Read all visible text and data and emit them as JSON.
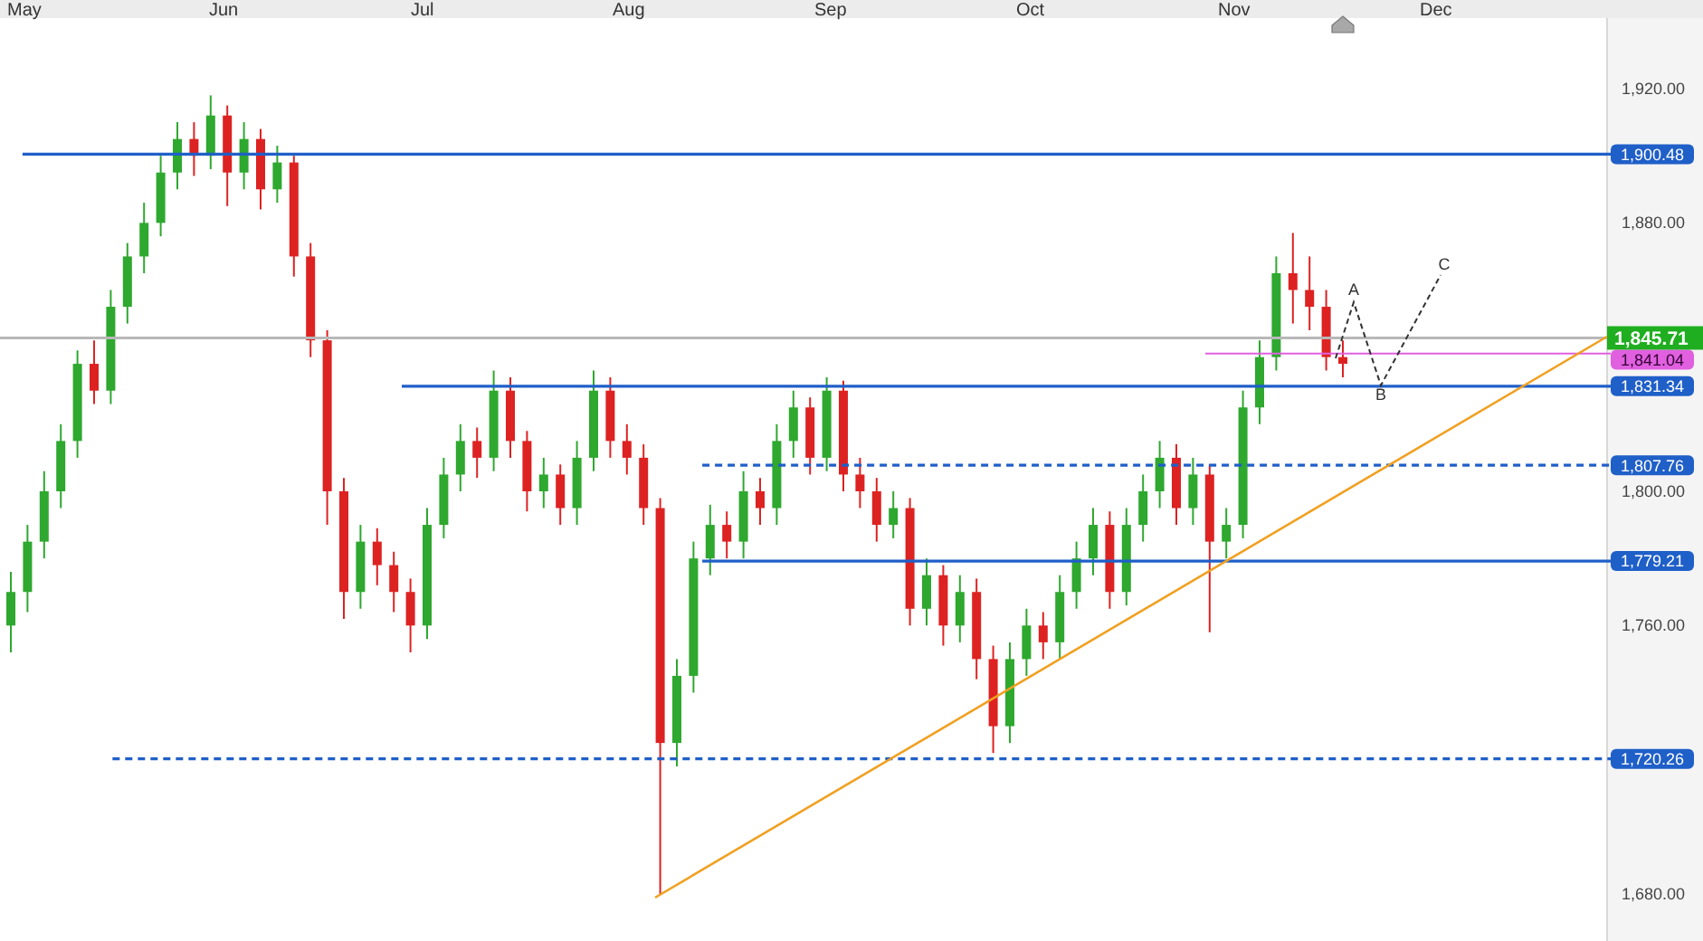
{
  "time_axis": {
    "months": [
      "May",
      "Jun",
      "Jul",
      "Aug",
      "Sep",
      "Oct",
      "Nov",
      "Dec"
    ]
  },
  "price_axis": {
    "ticks": [
      "1,920.00",
      "1,880.00",
      "1,800.00",
      "1,760.00",
      "1,680.00"
    ]
  },
  "levels": [
    {
      "label": "1,900.48",
      "kind": "solid",
      "color": "#1f5fc8"
    },
    {
      "label": "1,841.04",
      "kind": "solid",
      "color": "#e060e0"
    },
    {
      "label": "1,831.34",
      "kind": "solid",
      "color": "#1f5fc8"
    },
    {
      "label": "1,807.76",
      "kind": "dashed",
      "color": "#1f5fc8"
    },
    {
      "label": "1,779.21",
      "kind": "solid",
      "color": "#1f5fc8"
    },
    {
      "label": "1,720.26",
      "kind": "dashed",
      "color": "#1f5fc8"
    }
  ],
  "last_price": {
    "label": "1,845.71"
  },
  "wave_labels": [
    "A",
    "B",
    "C"
  ]
}
